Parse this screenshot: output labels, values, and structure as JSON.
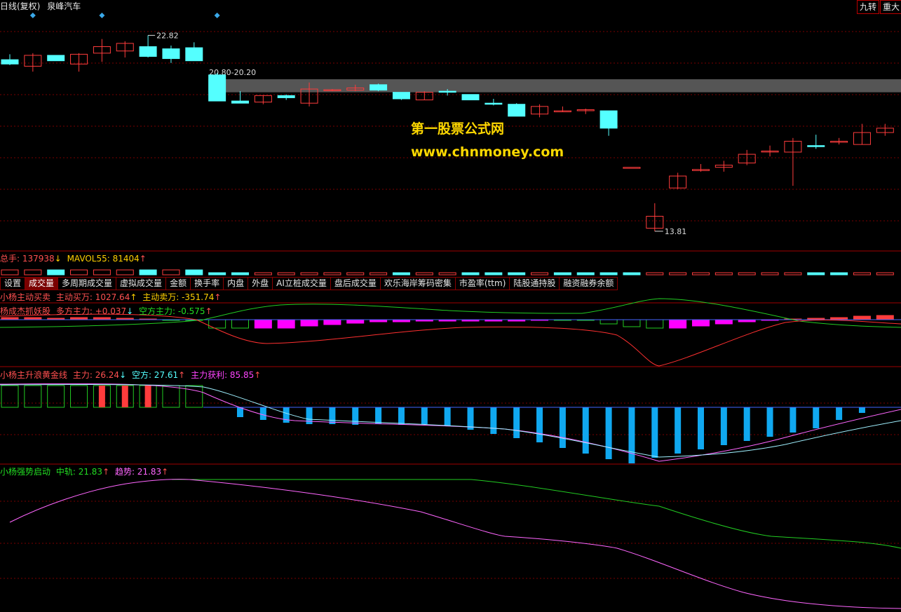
{
  "header": {
    "period_label": "日线(复权)",
    "stock_name": "泉峰汽车",
    "right_buttons": [
      "九转",
      "重大"
    ]
  },
  "price_panel": {
    "high_label": "22.82",
    "low_label": "13.81",
    "band_label": "20.80-20.20",
    "band_low": 20.2,
    "band_high": 20.8,
    "y_range": [
      13.0,
      23.8
    ],
    "markers": [
      1,
      4,
      9
    ]
  },
  "watermark": {
    "line1": "第一股票公式网",
    "line2": "www.chnmoney.com"
  },
  "volume_panel": {
    "label_total": "总手: 137938",
    "label_total_arrow": "↓",
    "label_mavol": "MAVOL55: 81404",
    "label_mavol_arrow": "↑"
  },
  "tabs": [
    "设置",
    "成交量",
    "多周期成交量",
    "虚拟成交量",
    "金额",
    "换手率",
    "内盘",
    "外盘",
    "AI立桩成交量",
    "盘后成交量",
    "欢乐海岸筹码密集",
    "市盈率(ttm)",
    "陆股通持股",
    "融资融券余额"
  ],
  "active_tab": 1,
  "panel1": {
    "name": "小杨主动买卖",
    "buy": "主动买万: 1027.64",
    "buy_arrow": "↑",
    "sell": "主动卖万: -351.74",
    "sell_arrow": "↑"
  },
  "panel2": {
    "name": "杨成杰抓妖股",
    "long": "多方主力: +0.037",
    "long_arrow": "↓",
    "short": "空方主力: -0.575",
    "short_arrow": "↑"
  },
  "panel3": {
    "name": "小杨主升浪黄金线",
    "main": "主力: 26.24",
    "main_arrow": "↓",
    "empty": "空方: 27.61",
    "empty_arrow": "↑",
    "profit": "主力获利: 85.85",
    "profit_arrow": "↑"
  },
  "panel4": {
    "name": "小杨强势启动",
    "mid": "中轨: 21.83",
    "mid_arrow": "↑",
    "trend": "趋势: 21.83",
    "trend_arrow": "↑"
  },
  "colors": {
    "up": "#ff3c3c",
    "down": "#54ffff",
    "grid": "#7a0000",
    "magenta": "#ff00ff",
    "blue_bar": "#10a8f0",
    "green_line": "#22cc22",
    "pink_line": "#ff66ff"
  },
  "chart_data": {
    "type": "candlestick",
    "candles": [
      {
        "o": 21.7,
        "h": 21.95,
        "l": 21.45,
        "c": 21.5
      },
      {
        "o": 21.4,
        "h": 22.0,
        "l": 21.15,
        "c": 21.9
      },
      {
        "o": 21.9,
        "h": 21.9,
        "l": 21.65,
        "c": 21.65
      },
      {
        "o": 21.5,
        "h": 22.0,
        "l": 21.15,
        "c": 21.95
      },
      {
        "o": 22.0,
        "h": 22.65,
        "l": 21.6,
        "c": 22.3
      },
      {
        "o": 22.1,
        "h": 22.55,
        "l": 21.8,
        "c": 22.45
      },
      {
        "o": 22.3,
        "h": 22.82,
        "l": 21.8,
        "c": 21.85
      },
      {
        "o": 22.2,
        "h": 22.35,
        "l": 21.55,
        "c": 21.75
      },
      {
        "o": 22.25,
        "h": 22.5,
        "l": 21.65,
        "c": 21.65
      },
      {
        "o": 21.0,
        "h": 21.1,
        "l": 19.8,
        "c": 19.8
      },
      {
        "o": 19.8,
        "h": 20.25,
        "l": 19.7,
        "c": 19.7
      },
      {
        "o": 19.75,
        "h": 20.05,
        "l": 19.65,
        "c": 20.05
      },
      {
        "o": 20.05,
        "h": 20.1,
        "l": 19.85,
        "c": 19.95
      },
      {
        "o": 19.7,
        "h": 20.65,
        "l": 19.55,
        "c": 20.35
      },
      {
        "o": 20.3,
        "h": 20.35,
        "l": 20.25,
        "c": 20.32
      },
      {
        "o": 20.3,
        "h": 20.55,
        "l": 20.25,
        "c": 20.4
      },
      {
        "o": 20.55,
        "h": 20.6,
        "l": 20.25,
        "c": 20.3
      },
      {
        "o": 20.2,
        "h": 20.2,
        "l": 19.85,
        "c": 19.9
      },
      {
        "o": 19.85,
        "h": 20.25,
        "l": 19.85,
        "c": 20.2
      },
      {
        "o": 20.25,
        "h": 20.35,
        "l": 20.05,
        "c": 20.22
      },
      {
        "o": 20.1,
        "h": 20.1,
        "l": 19.85,
        "c": 19.85
      },
      {
        "o": 19.7,
        "h": 19.9,
        "l": 19.6,
        "c": 19.65
      },
      {
        "o": 19.65,
        "h": 19.7,
        "l": 19.1,
        "c": 19.1
      },
      {
        "o": 19.2,
        "h": 19.65,
        "l": 19.05,
        "c": 19.55
      },
      {
        "o": 19.35,
        "h": 19.55,
        "l": 19.3,
        "c": 19.35
      },
      {
        "o": 19.4,
        "h": 19.45,
        "l": 19.2,
        "c": 19.4
      },
      {
        "o": 19.35,
        "h": 19.35,
        "l": 18.2,
        "c": 18.55
      },
      {
        "o": 16.75,
        "h": 16.75,
        "l": 16.75,
        "c": 16.75
      },
      {
        "o": 13.95,
        "h": 15.1,
        "l": 13.81,
        "c": 14.5
      },
      {
        "o": 15.8,
        "h": 16.5,
        "l": 15.75,
        "c": 16.35
      },
      {
        "o": 16.6,
        "h": 16.9,
        "l": 16.55,
        "c": 16.65
      },
      {
        "o": 16.75,
        "h": 17.05,
        "l": 16.55,
        "c": 16.85
      },
      {
        "o": 16.95,
        "h": 17.55,
        "l": 16.85,
        "c": 17.35
      },
      {
        "o": 17.5,
        "h": 17.75,
        "l": 17.25,
        "c": 17.5
      },
      {
        "o": 17.45,
        "h": 18.1,
        "l": 15.9,
        "c": 17.95
      },
      {
        "o": 17.75,
        "h": 18.25,
        "l": 17.6,
        "c": 17.7
      },
      {
        "o": 17.9,
        "h": 18.1,
        "l": 17.8,
        "c": 17.95
      },
      {
        "o": 17.8,
        "h": 18.75,
        "l": 17.8,
        "c": 18.35
      },
      {
        "o": 18.35,
        "h": 18.75,
        "l": 18.2,
        "c": 18.55
      }
    ],
    "volume_up": [
      true,
      true,
      false,
      true,
      true,
      true,
      false,
      true,
      false,
      false,
      false,
      true,
      true,
      true,
      true,
      true,
      true,
      false,
      true,
      true,
      false,
      false,
      false,
      true,
      false,
      false,
      false,
      false,
      true,
      true,
      true,
      true,
      true,
      true,
      true,
      false,
      false,
      true,
      true
    ]
  }
}
